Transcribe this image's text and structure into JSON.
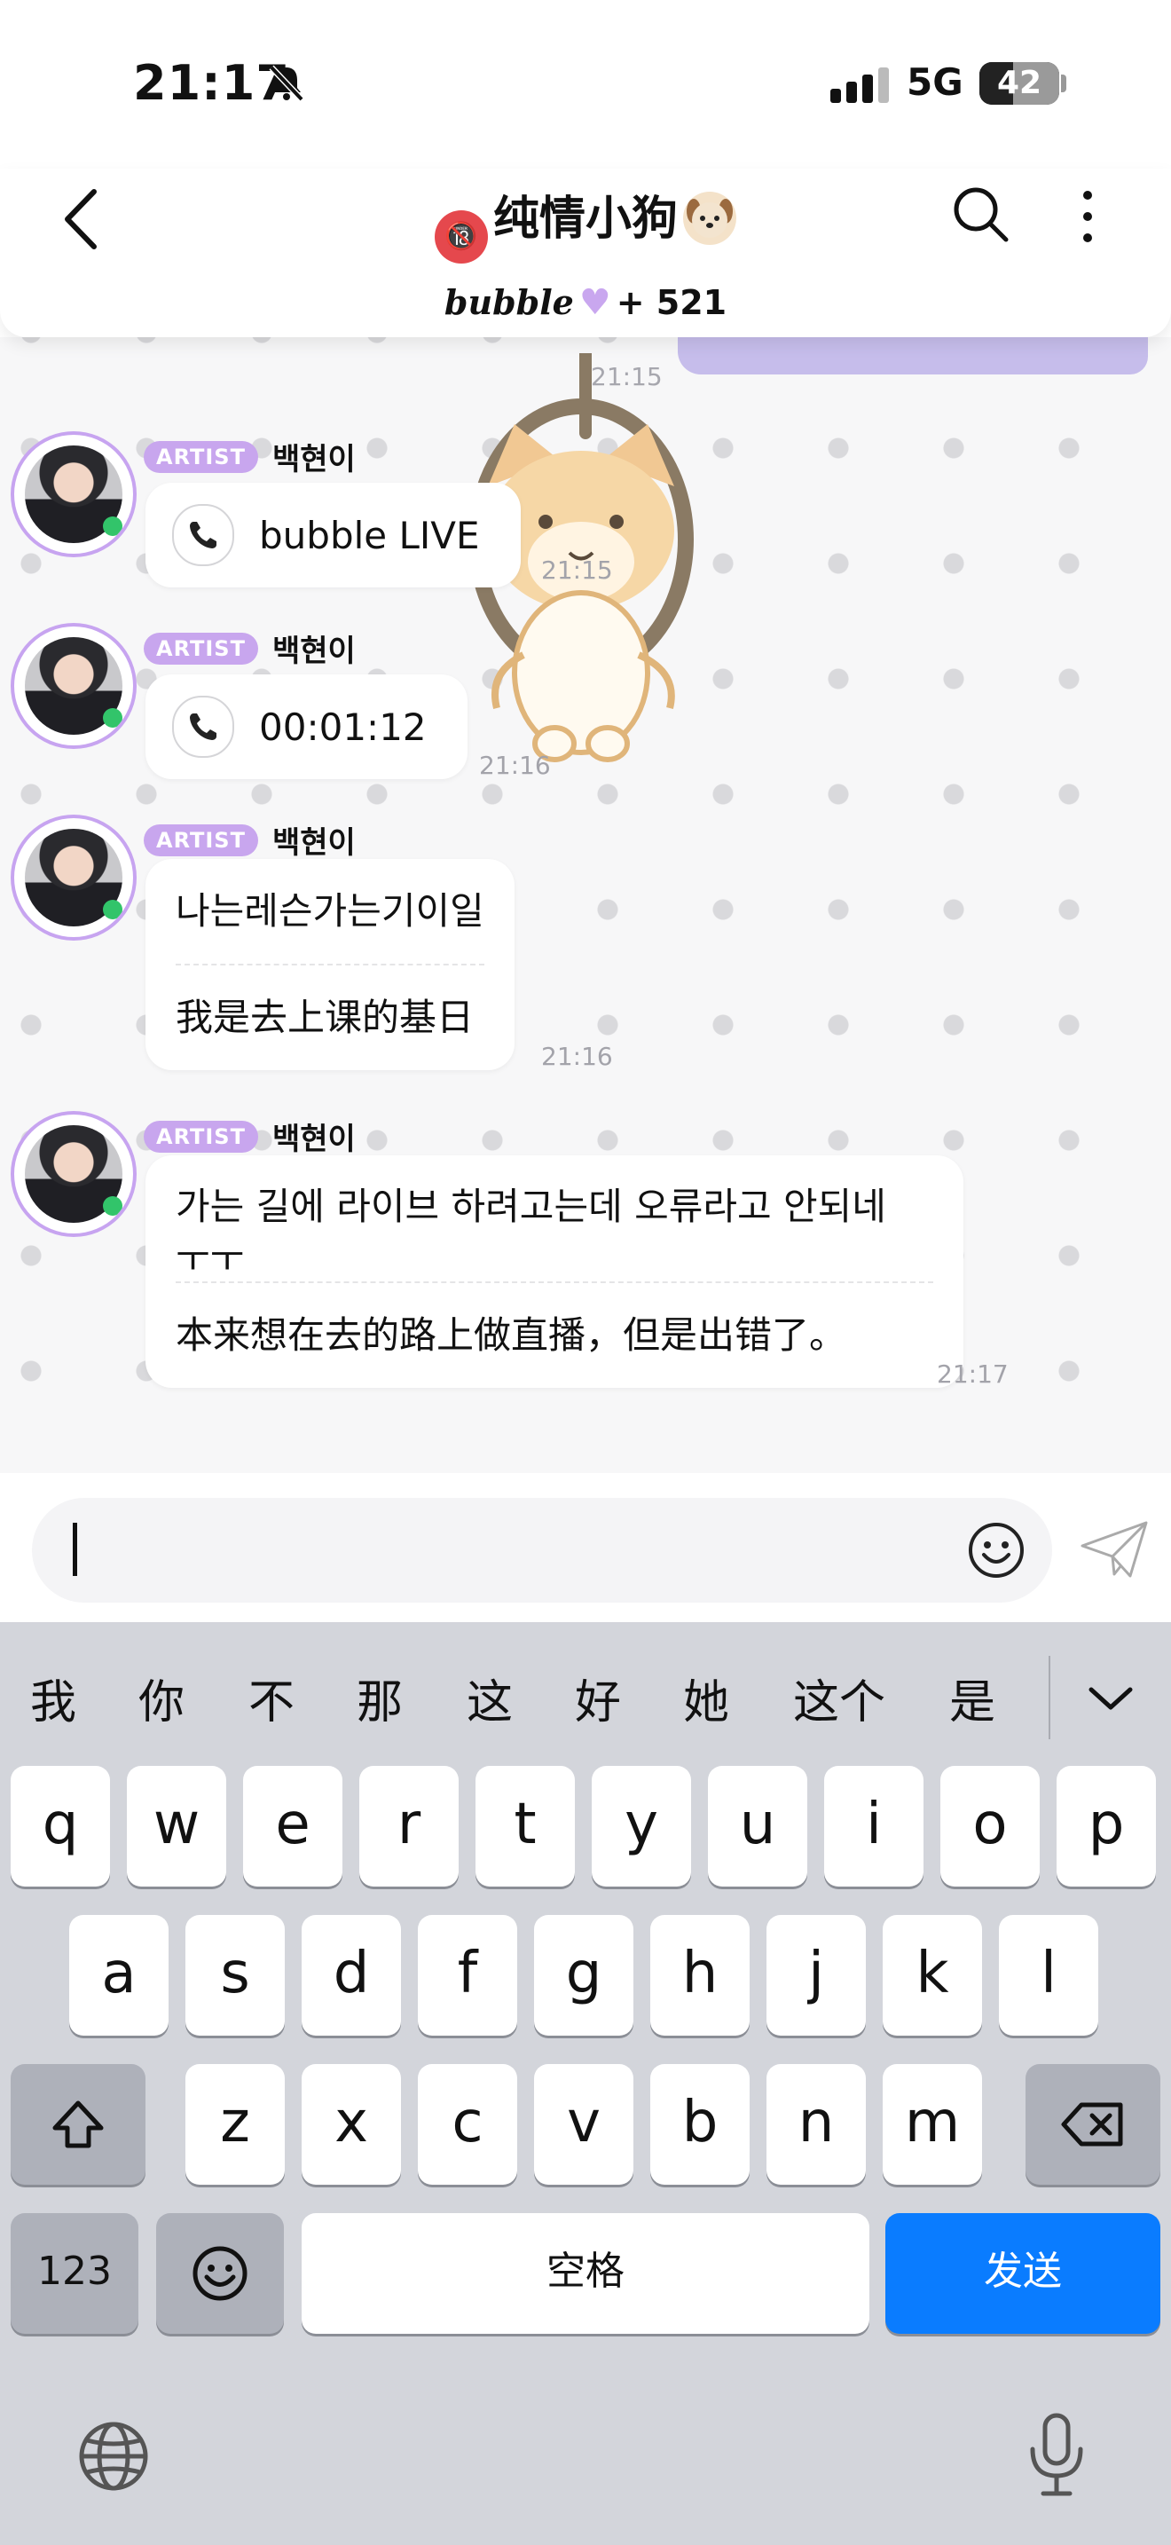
{
  "status_bar": {
    "time": "21:17",
    "network": "5G",
    "battery": "42",
    "battery_level": 0.42
  },
  "header": {
    "title": "纯情小狗",
    "title_prefix_emoji": "🔞",
    "title_suffix_emoji": "dog-face",
    "brand": "bubble",
    "subscriber_count": "+ 521"
  },
  "chat": {
    "top_time": "21:15",
    "messages": [
      {
        "badge": "ARTIST",
        "name": "백현이",
        "kind": "call",
        "text": "bubble LIVE",
        "time": "21:15",
        "icon": "phone-icon"
      },
      {
        "badge": "ARTIST",
        "name": "백현이",
        "kind": "call",
        "text": "00:01:12",
        "time": "21:16",
        "icon": "phone-icon"
      },
      {
        "badge": "ARTIST",
        "name": "백현이",
        "kind": "text",
        "original": "나는레슨가는기이일",
        "translation": "我是去上课的基日",
        "time": "21:16"
      },
      {
        "badge": "ARTIST",
        "name": "백현이",
        "kind": "text",
        "original_line1": "가는 길에 라이브 하려고는데 오류라고 안되네",
        "original_line2": "ㅜㅜ",
        "translation": "本来想在去的路上做直播，但是出错了。",
        "time": "21:17"
      }
    ]
  },
  "input": {
    "value": "",
    "emoji_icon": "smiley-icon",
    "send_icon": "paper-plane-icon"
  },
  "keyboard": {
    "candidates": [
      "我",
      "你",
      "不",
      "那",
      "这",
      "好",
      "她",
      "这个",
      "是"
    ],
    "row1": [
      "q",
      "w",
      "e",
      "r",
      "t",
      "y",
      "u",
      "i",
      "o",
      "p"
    ],
    "row2": [
      "a",
      "s",
      "d",
      "f",
      "g",
      "h",
      "j",
      "k",
      "l"
    ],
    "row3": [
      "z",
      "x",
      "c",
      "v",
      "b",
      "n",
      "m"
    ],
    "numbers_key": "123",
    "space_key": "空格",
    "send_key": "发送",
    "colors": {
      "send_key": "#0a7cff",
      "background": "#d3d5db",
      "artist_badge": "#c8a6ee"
    }
  }
}
